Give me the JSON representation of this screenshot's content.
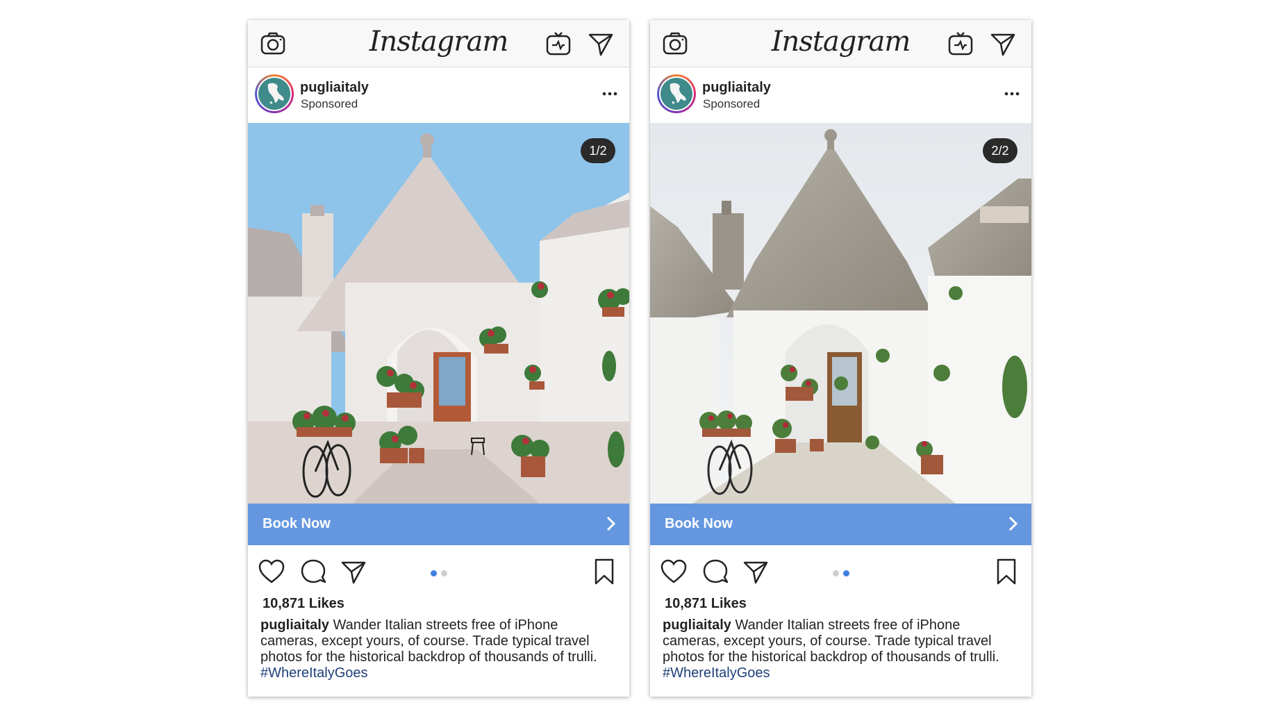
{
  "app": {
    "logo_text": "Instagram"
  },
  "colors": {
    "cta_blue": "#6597e0",
    "hashtag_blue": "#1f3f7a",
    "dot_active": "#3d7fe0",
    "dot_inactive": "#cfcfcf"
  },
  "icons": {
    "top_bar": [
      "camera-icon",
      "igtv-icon",
      "direct-message-icon"
    ],
    "post_actions": [
      "heart-icon",
      "comment-icon",
      "share-icon",
      "bookmark-icon"
    ],
    "post_header": [
      "more-options-icon"
    ],
    "cta": [
      "chevron-right-icon"
    ]
  },
  "posts": [
    {
      "username": "pugliaitaly",
      "sponsored": "Sponsored",
      "counter": "1/2",
      "image_style": "illustration",
      "active_dot": 1,
      "cta_label": "Book Now",
      "likes": "10,871 Likes",
      "caption_user": "pugliaitaly",
      "caption_text": " Wander Italian streets free of iPhone cameras, except yours, of course. Trade typical travel photos for the historical backdrop of thousands of trulli. ",
      "caption_hashtag": "#WhereItalyGoes"
    },
    {
      "username": "pugliaitaly",
      "sponsored": "Sponsored",
      "counter": "2/2",
      "image_style": "photograph",
      "active_dot": 2,
      "cta_label": "Book Now",
      "likes": "10,871 Likes",
      "caption_user": "pugliaitaly",
      "caption_text": " Wander Italian streets free of iPhone cameras, except yours, of course. Trade typical travel photos for the historical backdrop of thousands of trulli. ",
      "caption_hashtag": "#WhereItalyGoes"
    }
  ]
}
